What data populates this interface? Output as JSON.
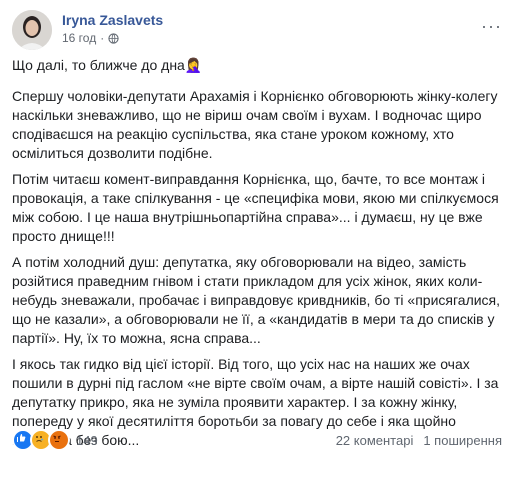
{
  "header": {
    "author": "Iryna Zaslavets",
    "time": "16 год",
    "more": "···"
  },
  "post": {
    "line1": "Що далі, то ближче до дна🤦‍♀️",
    "p1": "Спершу чоловіки-депутати Арахамія і Корнієнко обговорюють жінку-колегу наскільки зневажливо, що не віриш очам своїм і вухам. І водночас щиро сподіваєшся на реакцію суспільства, яка стане уроком кожному, хто осмілиться дозволити подібне.",
    "p2": "Потім читаєш комент-виправдання Корнієнка, що, бачте, то все монтаж і провокація, а таке спілкування - це «специфіка мови, якою ми спілкуємося між собою. І це наша внутрішньопартійна справа»... і думаєш, ну це вже просто днище!!!",
    "p3": "А потім холодний душ: депутатка, яку обговорювали на відео, замість розійтися праведним гнівом і стати прикладом для усіх жінок, яких коли-небудь зневажали, пробачає і виправдовує кривдників, бо ті «присягалися, що не казали», а обговорювали не її, а «кандидатів в мери та до списків у партії». Ну, їх то можна, ясна справа...",
    "p4": "І якось так гидко від цієї історії. Від того, що усіх нас на наших же очах пошили в дурні під гаслом «не вірте своїм очам, а вірте нашій совісті». І за депутатку прикро, яка не зуміла проявити характер. І за кожну жінку, попереду у якої десятиліття боротьби за повагу до себе і яка щойно програла без бою..."
  },
  "footer": {
    "reaction_count": "149",
    "comments": "22 коментарі",
    "shares": "1 поширення"
  },
  "colors": {
    "author": "#385898",
    "like": "#1877f2",
    "sad": "#f7b125",
    "angry": "#e9710f"
  },
  "icons": [
    "avatar",
    "globe-icon",
    "more-icon",
    "like-icon",
    "sad-icon",
    "angry-icon"
  ]
}
